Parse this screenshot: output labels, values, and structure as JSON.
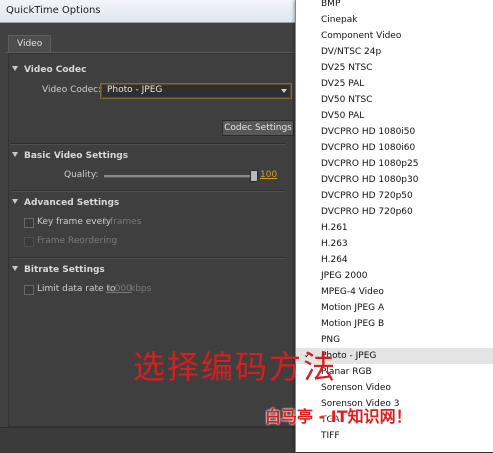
{
  "window": {
    "title": "QuickTime Options"
  },
  "tabs": [
    {
      "label": "Video"
    }
  ],
  "video_codec": {
    "section_label": "Video Codec",
    "field_label": "Video Codec:",
    "value": "Photo - JPEG",
    "button_label": "Codec Settings"
  },
  "basic_video": {
    "section_label": "Basic Video Settings",
    "quality_label": "Quality:",
    "quality_value": "100"
  },
  "advanced": {
    "section_label": "Advanced Settings",
    "keyframe_label": "Key frame every",
    "keyframe_value": "1",
    "keyframe_unit": "frames",
    "frame_reordering_label": "Frame Reordering"
  },
  "bitrate": {
    "section_label": "Bitrate Settings",
    "limit_label": "Limit data rate to",
    "limit_value": "1,000",
    "limit_unit": "kbps"
  },
  "codec_list": {
    "items": [
      "BMP",
      "Cinepak",
      "Component Video",
      "DV/NTSC 24p",
      "DV25 NTSC",
      "DV25 PAL",
      "DV50 NTSC",
      "DV50 PAL",
      "DVCPRO HD 1080i50",
      "DVCPRO HD 1080i60",
      "DVCPRO HD 1080p25",
      "DVCPRO HD 1080p30",
      "DVCPRO HD 720p50",
      "DVCPRO HD 720p60",
      "H.261",
      "H.263",
      "H.264",
      "JPEG 2000",
      "MPEG-4 Video",
      "Motion JPEG A",
      "Motion JPEG B",
      "PNG",
      "Photo - JPEG",
      "Planar RGB",
      "Sorenson Video",
      "Sorenson Video 3",
      "TGA",
      "TIFF"
    ],
    "selected_index": 22,
    "check_mark": "✓"
  },
  "overlay": {
    "caption": "选择编码方法",
    "watermark": "白马亭 - IT知识网！"
  }
}
